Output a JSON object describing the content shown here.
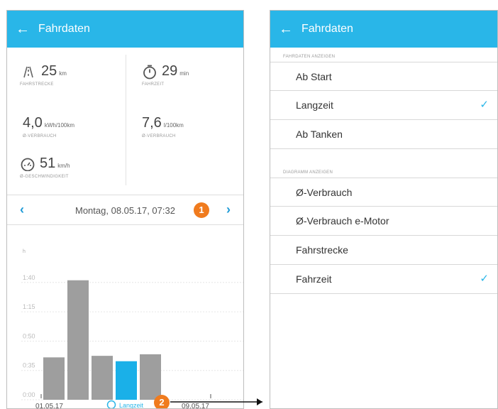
{
  "left_screen": {
    "title": "Fahrdaten",
    "stats": {
      "distance": {
        "value": "25",
        "unit": "km",
        "label": "FAHRSTRECKE"
      },
      "duration": {
        "value": "29",
        "unit": "min",
        "label": "FAHRZEIT"
      },
      "consumption_kwh": {
        "value": "4,0",
        "unit": "kWh/100km",
        "label": "Ø-VERBRAUCH"
      },
      "consumption_l": {
        "value": "7,6",
        "unit": "l/100km",
        "label": "Ø-VERBRAUCH"
      },
      "speed": {
        "value": "51",
        "unit": "km/h",
        "label": "Ø-GESCHWINDIGKEIT"
      }
    },
    "date_bar": {
      "date": "Montag, 08.05.17, 07:32",
      "badge": "1"
    },
    "chart_footer": {
      "start": "01.05.17",
      "mode": "Langzeit",
      "end": "09.05.17",
      "badge": "2"
    }
  },
  "right_screen": {
    "title": "Fahrdaten",
    "section1": "FAHRDATEN ANZEIGEN",
    "section1_items": [
      "Ab Start",
      "Langzeit",
      "Ab Tanken"
    ],
    "section2": "DIAGRAMM ANZEIGEN",
    "section2_items": [
      "Ø-Verbrauch",
      "Ø-Verbrauch e-Motor",
      "Fahrstrecke",
      "Fahrzeit"
    ],
    "checkmark": "✓"
  },
  "icons": {
    "back": "←",
    "prev": "‹",
    "next": "›",
    "road_icon": "road-icon",
    "stopwatch_icon": "stopwatch-icon",
    "speedometer_icon": "speedometer-icon"
  },
  "colors": {
    "accent": "#29b6e8",
    "bar_gray": "#9e9e9e",
    "bar_selected": "#1ab0e8",
    "badge": "#f07b1e"
  },
  "chart_data": {
    "type": "bar",
    "ylabel": "h",
    "yticks": [
      "0:00",
      "0:35",
      "0:50",
      "1:15",
      "1:40"
    ],
    "ylim": [
      0,
      1.75
    ],
    "xlabel_start": "01.05.17",
    "xlabel_end": "09.05.17",
    "values": [
      0.55,
      1.55,
      0.57,
      0.5,
      0.59
    ],
    "selected_index": 3,
    "grid": true
  }
}
